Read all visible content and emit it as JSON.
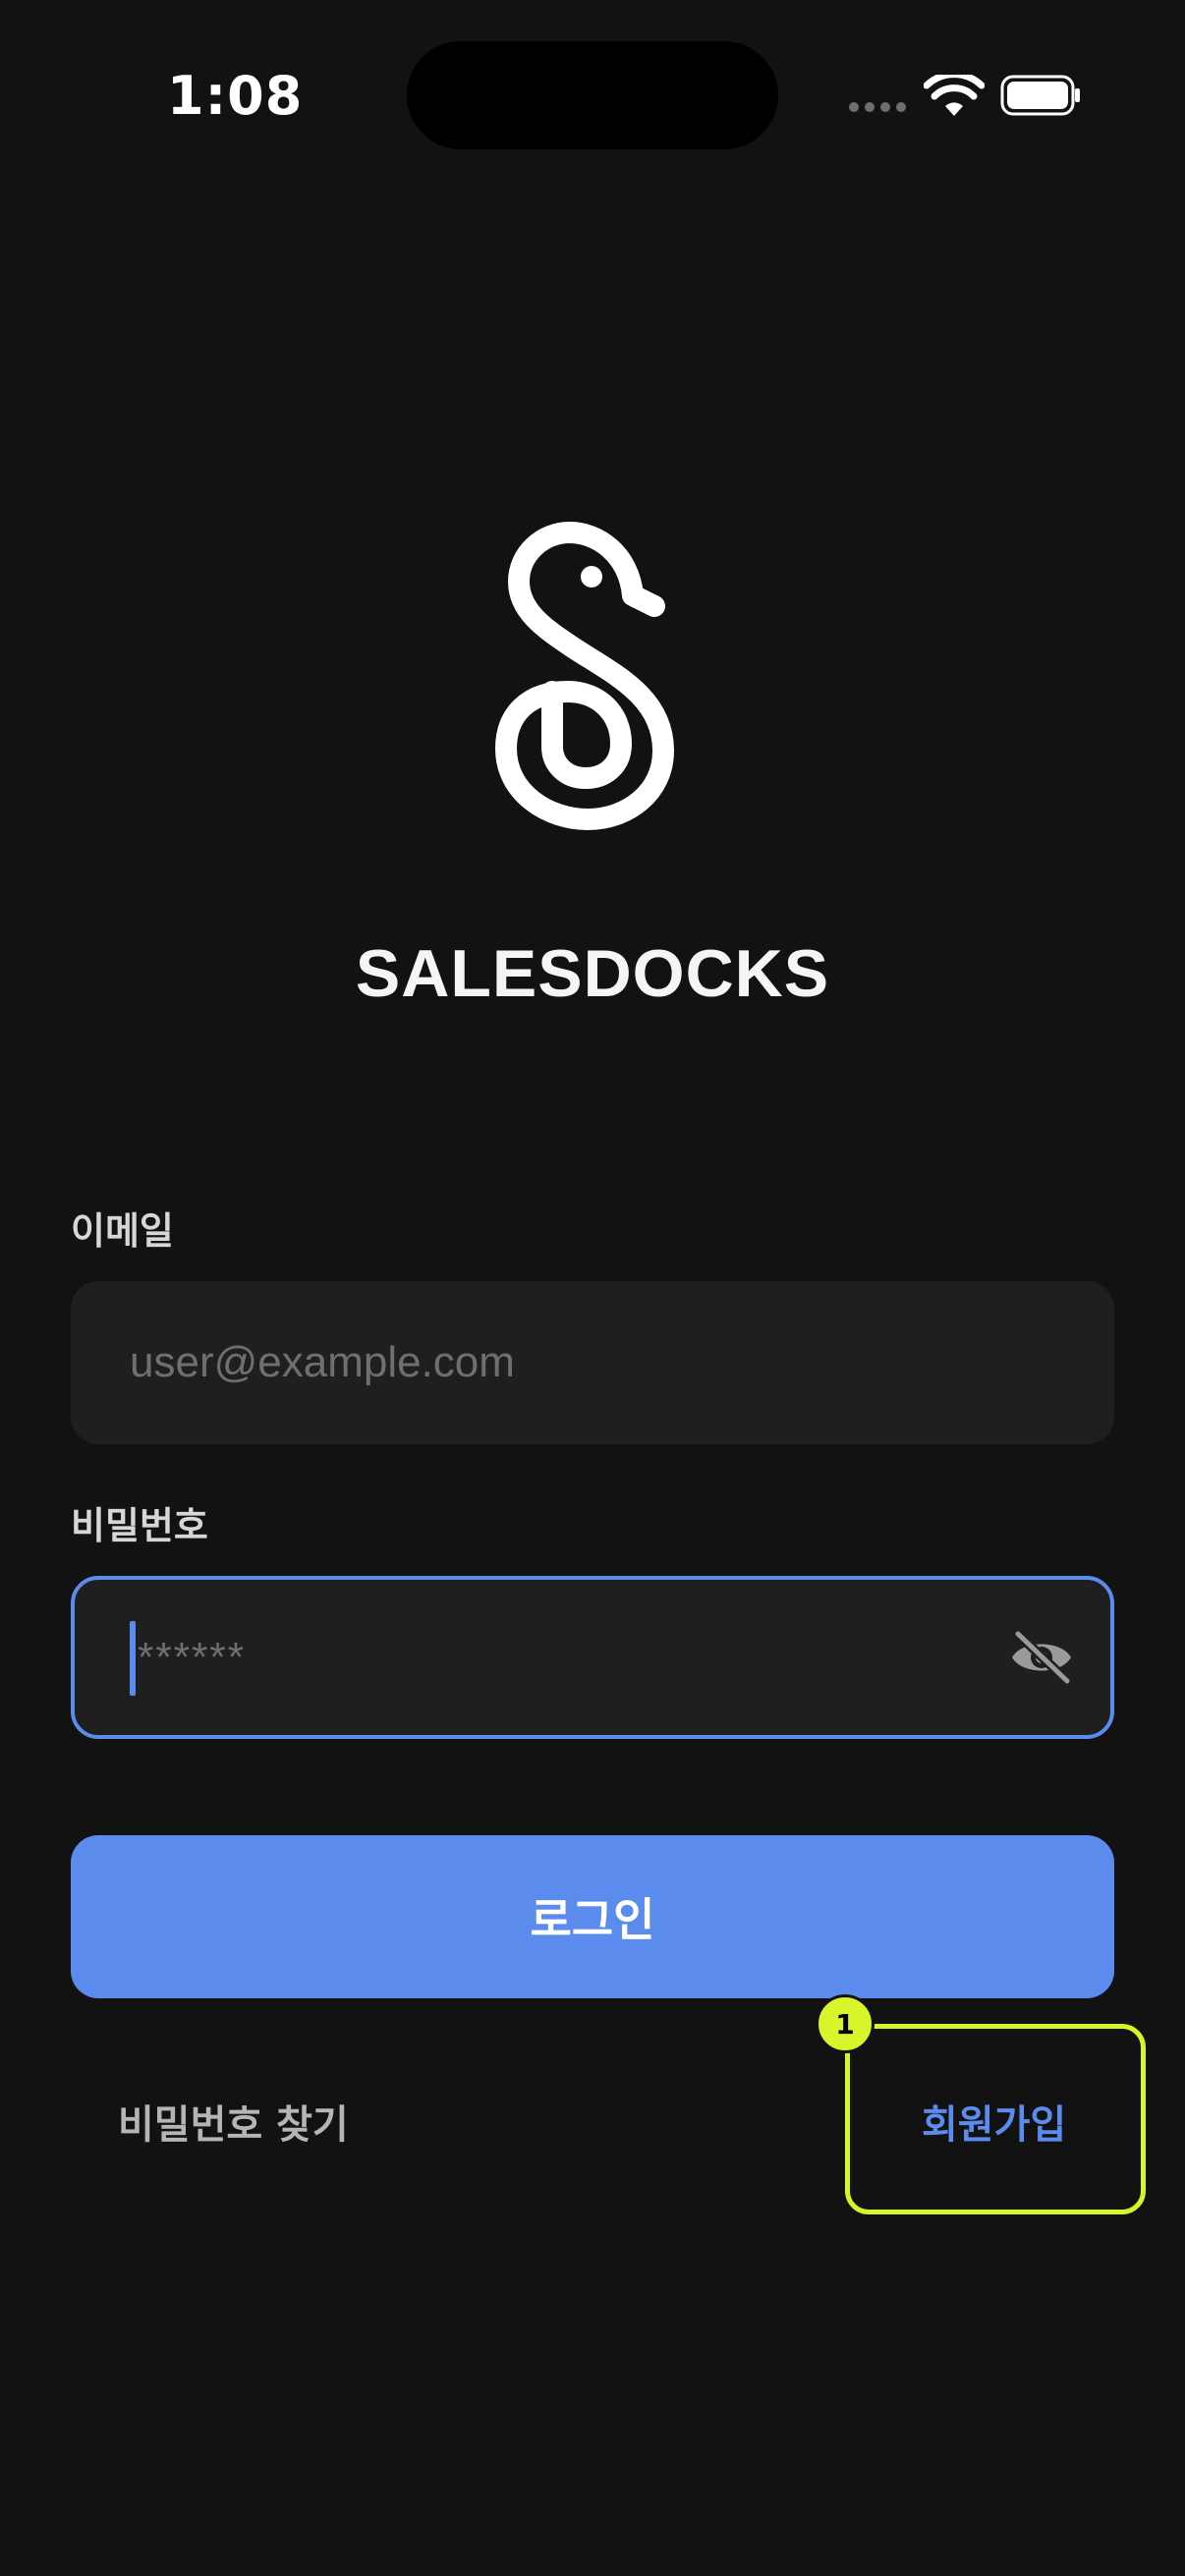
{
  "status_bar": {
    "time": "1:08"
  },
  "logo": {
    "icon": "duck-s-logo-icon",
    "title": "SALESDOCKS"
  },
  "form": {
    "email_label": "이메일",
    "email_placeholder": "user@example.com",
    "email_value": "",
    "password_label": "비밀번호",
    "password_placeholder": "******",
    "password_value": "",
    "password_visibility_icon": "eye-off-icon"
  },
  "actions": {
    "login_label": "로그인",
    "find_password_label": "비밀번호 찾기",
    "signup_label": "회원가입"
  },
  "annotation": {
    "badge": "1"
  },
  "colors": {
    "background": "#121212",
    "accent": "#5b8ced",
    "input_bg": "#1f1f1f",
    "highlight": "#d7f52a"
  }
}
